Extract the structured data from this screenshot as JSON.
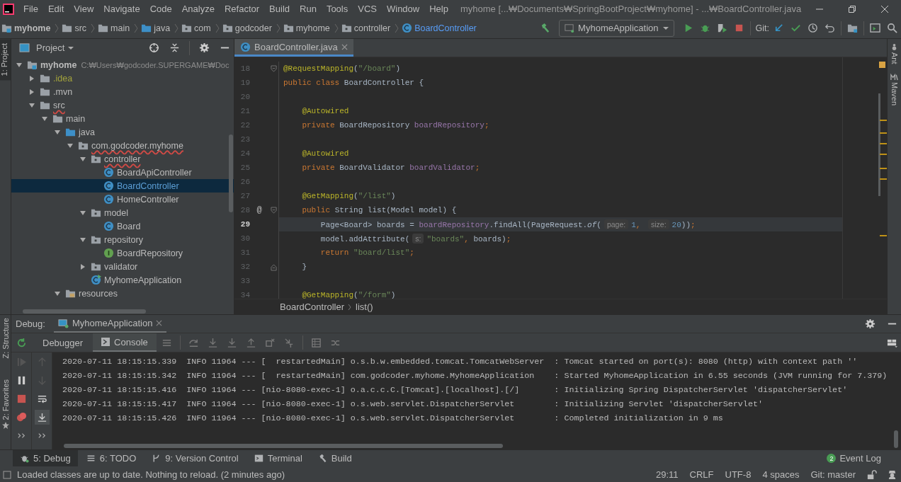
{
  "window": {
    "title": "myhome [...₩Documents₩SpringBootProject₩myhome] - ...₩BoardController.java"
  },
  "menu": [
    "File",
    "Edit",
    "View",
    "Navigate",
    "Code",
    "Analyze",
    "Refactor",
    "Build",
    "Run",
    "Tools",
    "VCS",
    "Window",
    "Help"
  ],
  "breadcrumbs": [
    {
      "label": "myhome",
      "kind": "module"
    },
    {
      "label": "src",
      "kind": "folder"
    },
    {
      "label": "main",
      "kind": "folder"
    },
    {
      "label": "java",
      "kind": "source"
    },
    {
      "label": "com",
      "kind": "package"
    },
    {
      "label": "godcoder",
      "kind": "package"
    },
    {
      "label": "myhome",
      "kind": "package"
    },
    {
      "label": "controller",
      "kind": "package"
    },
    {
      "label": "BoardController",
      "kind": "class"
    }
  ],
  "run_config": {
    "label": "MyhomeApplication"
  },
  "vcs_label": "Git:",
  "side_tabs_left": [
    {
      "label": "1: Project",
      "selected": true
    },
    {
      "label": "Z: Structure",
      "selected": false
    },
    {
      "label": "2: Favorites",
      "selected": false
    }
  ],
  "side_tabs_right": [
    {
      "label": "Ant",
      "kind": "ant"
    },
    {
      "label": "Maven",
      "kind": "maven"
    }
  ],
  "project_panel": {
    "title": "Project",
    "tree": [
      {
        "label": "myhome",
        "kind": "module",
        "path": "C:₩Users₩godcoder.SUPERGAME₩Doc",
        "expanded": true,
        "selected": false,
        "children": [
          {
            "label": ".idea",
            "kind": "folder",
            "expanded": false,
            "selected": false,
            "color": "#a3a33c"
          },
          {
            "label": ".mvn",
            "kind": "folder",
            "expanded": false,
            "selected": false
          },
          {
            "label": "src",
            "kind": "folder",
            "expanded": true,
            "selected": false,
            "problems": true,
            "children": [
              {
                "label": "main",
                "kind": "folder",
                "expanded": true,
                "selected": false,
                "children": [
                  {
                    "label": "java",
                    "kind": "source",
                    "expanded": true,
                    "selected": false,
                    "children": [
                      {
                        "label": "com.godcoder.myhome",
                        "kind": "package",
                        "expanded": true,
                        "selected": false,
                        "problems": true,
                        "children": [
                          {
                            "label": "controller",
                            "kind": "package",
                            "expanded": true,
                            "selected": false,
                            "problems": true,
                            "children": [
                              {
                                "label": "BoardApiController",
                                "kind": "class",
                                "selected": false
                              },
                              {
                                "label": "BoardController",
                                "kind": "class",
                                "selected": true,
                                "color": "#5c9fd6"
                              },
                              {
                                "label": "HomeController",
                                "kind": "class",
                                "selected": false
                              }
                            ]
                          },
                          {
                            "label": "model",
                            "kind": "package",
                            "expanded": true,
                            "selected": false,
                            "children": [
                              {
                                "label": "Board",
                                "kind": "class",
                                "selected": false
                              }
                            ]
                          },
                          {
                            "label": "repository",
                            "kind": "package",
                            "expanded": true,
                            "selected": false,
                            "children": [
                              {
                                "label": "BoardRepository",
                                "kind": "interface",
                                "selected": false
                              }
                            ]
                          },
                          {
                            "label": "validator",
                            "kind": "package",
                            "expanded": false,
                            "selected": false
                          },
                          {
                            "label": "MyhomeApplication",
                            "kind": "app",
                            "selected": false
                          }
                        ]
                      }
                    ]
                  },
                  {
                    "label": "resources",
                    "kind": "resources",
                    "expanded": true,
                    "selected": false
                  }
                ]
              }
            ]
          }
        ]
      }
    ]
  },
  "editor": {
    "tabs": [
      {
        "label": "BoardController.java",
        "selected": true
      }
    ],
    "lines": [
      {
        "number": "18",
        "current": false,
        "kind": "fold_start",
        "tokens": [
          {
            "kind": "annotation",
            "text": "@RequestMapping"
          },
          {
            "kind": "plain",
            "text": "("
          },
          {
            "kind": "string",
            "text": "\"/board\""
          },
          {
            "kind": "plain",
            "text": ")"
          }
        ]
      },
      {
        "number": "19",
        "current": false,
        "kind": "code",
        "tokens": [
          {
            "kind": "keyword",
            "text": "public class "
          },
          {
            "kind": "plain",
            "text": "BoardController {"
          }
        ]
      },
      {
        "number": "20",
        "current": false,
        "kind": "code"
      },
      {
        "number": "21",
        "current": false,
        "kind": "code",
        "tokens": [
          {
            "kind": "annotation",
            "text": "    @Autowired"
          }
        ]
      },
      {
        "number": "22",
        "current": false,
        "kind": "code",
        "tokens": [
          {
            "kind": "keyword",
            "text": "    private "
          },
          {
            "kind": "plain",
            "text": "BoardRepository "
          },
          {
            "kind": "field",
            "text": "boardRepository"
          },
          {
            "kind": "keyword",
            "text": ";"
          }
        ]
      },
      {
        "number": "23",
        "current": false,
        "kind": "code"
      },
      {
        "number": "24",
        "current": false,
        "kind": "code",
        "tokens": [
          {
            "kind": "annotation",
            "text": "    @Autowired"
          }
        ]
      },
      {
        "number": "25",
        "current": false,
        "kind": "code",
        "tokens": [
          {
            "kind": "keyword",
            "text": "    private "
          },
          {
            "kind": "plain",
            "text": "BoardValidator "
          },
          {
            "kind": "field",
            "text": "boardValidator"
          },
          {
            "kind": "keyword",
            "text": ";"
          }
        ]
      },
      {
        "number": "26",
        "current": false,
        "kind": "code"
      },
      {
        "number": "27",
        "current": false,
        "kind": "code",
        "tokens": [
          {
            "kind": "annotation",
            "text": "    @GetMapping"
          },
          {
            "kind": "plain",
            "text": "("
          },
          {
            "kind": "string",
            "text": "\"/list\""
          },
          {
            "kind": "plain",
            "text": ")"
          }
        ]
      },
      {
        "number": "28",
        "current": false,
        "gutter": "@",
        "kind": "fold_start",
        "tokens": [
          {
            "kind": "keyword",
            "text": "    public "
          },
          {
            "kind": "plain",
            "text": "String list(Model model) {"
          }
        ]
      },
      {
        "number": "29",
        "current": true,
        "kind": "code",
        "tokens": [
          {
            "kind": "plain",
            "text": "        Page<Board> boards = "
          },
          {
            "kind": "field",
            "text": "boardRepository"
          },
          {
            "kind": "plain",
            "text": ".findAll(PageRequest."
          },
          {
            "kind": "italic",
            "text": "of"
          },
          {
            "kind": "plain",
            "text": "("
          },
          {
            "kind": "hint",
            "text": "page:"
          },
          {
            "kind": "number",
            "text": "1"
          },
          {
            "kind": "keyword",
            "text": ", "
          },
          {
            "kind": "hint",
            "text": "size:"
          },
          {
            "kind": "number",
            "text": "20"
          },
          {
            "kind": "plain",
            "text": "))"
          },
          {
            "kind": "keyword",
            "text": ";"
          }
        ]
      },
      {
        "number": "30",
        "current": false,
        "kind": "code",
        "tokens": [
          {
            "kind": "plain",
            "text": "        model.addAttribute("
          },
          {
            "kind": "hint",
            "text": "s:"
          },
          {
            "kind": "string",
            "text": "\"boards\""
          },
          {
            "kind": "keyword",
            "text": ", "
          },
          {
            "kind": "plain",
            "text": "boards)"
          },
          {
            "kind": "keyword",
            "text": ";"
          }
        ]
      },
      {
        "number": "31",
        "current": false,
        "kind": "code",
        "tokens": [
          {
            "kind": "keyword",
            "text": "        return "
          },
          {
            "kind": "string",
            "text": "\"board/list\""
          },
          {
            "kind": "keyword",
            "text": ";"
          }
        ]
      },
      {
        "number": "32",
        "current": false,
        "kind": "fold_end",
        "tokens": [
          {
            "kind": "plain",
            "text": "    }"
          }
        ]
      },
      {
        "number": "33",
        "current": false,
        "kind": "code"
      },
      {
        "number": "34",
        "current": false,
        "kind": "code",
        "tokens": [
          {
            "kind": "annotation",
            "text": "    @GetMapping"
          },
          {
            "kind": "plain",
            "text": "("
          },
          {
            "kind": "string",
            "text": "\"/form\""
          },
          {
            "kind": "plain",
            "text": ")"
          }
        ]
      }
    ],
    "breadcrumbs": [
      "BoardController",
      "list()"
    ]
  },
  "debug": {
    "title": "Debug:",
    "sessions": [
      {
        "label": "MyhomeApplication",
        "selected": true
      }
    ],
    "tabs": [
      {
        "label": "Debugger",
        "selected": false
      },
      {
        "label": "Console",
        "selected": true
      }
    ],
    "console": [
      "2020-07-11 18:15:15.339  INFO 11964 --- [  restartedMain] o.s.b.w.embedded.tomcat.TomcatWebServer  : Tomcat started on port(s): 8080 (http) with context path ''",
      "2020-07-11 18:15:15.342  INFO 11964 --- [  restartedMain] com.godcoder.myhome.MyhomeApplication    : Started MyhomeApplication in 6.55 seconds (JVM running for 7.379)",
      "2020-07-11 18:15:15.416  INFO 11964 --- [nio-8080-exec-1] o.a.c.c.C.[Tomcat].[localhost].[/]       : Initializing Spring DispatcherServlet 'dispatcherServlet'",
      "2020-07-11 18:15:15.417  INFO 11964 --- [nio-8080-exec-1] o.s.web.servlet.DispatcherServlet        : Initializing Servlet 'dispatcherServlet'",
      "2020-07-11 18:15:15.426  INFO 11964 --- [nio-8080-exec-1] o.s.web.servlet.DispatcherServlet        : Completed initialization in 9 ms"
    ]
  },
  "tool_tabs": [
    {
      "label": "5: Debug",
      "kind": "debug",
      "selected": true
    },
    {
      "label": "6: TODO",
      "kind": "todo",
      "selected": false
    },
    {
      "label": "9: Version Control",
      "kind": "vcs",
      "selected": false
    },
    {
      "label": "Terminal",
      "kind": "terminal",
      "selected": false
    },
    {
      "label": "Build",
      "kind": "build",
      "selected": false
    }
  ],
  "event_log": {
    "label": "Event Log",
    "count": "2"
  },
  "status": {
    "message": "Loaded classes are up to date. Nothing to reload. (2 minutes ago)",
    "items": [
      "29:11",
      "CRLF",
      "UTF-8",
      "4 spaces",
      "Git: master"
    ]
  }
}
